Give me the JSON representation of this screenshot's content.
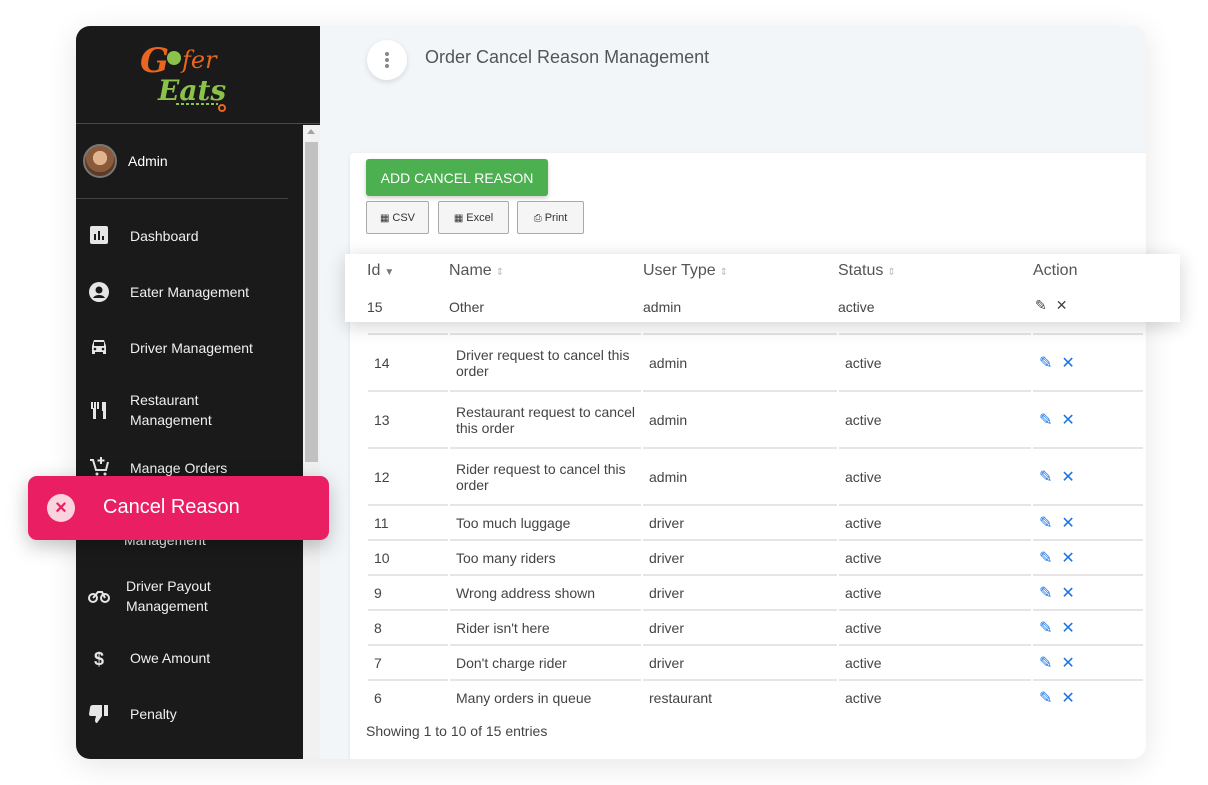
{
  "app": {
    "brand": "Gofer Eats"
  },
  "sidebar": {
    "user": {
      "name": "Admin"
    },
    "items": [
      {
        "label": "Dashboard",
        "icon": "bar-chart-icon"
      },
      {
        "label": "Eater Management",
        "icon": "account-circle-icon"
      },
      {
        "label": "Driver Management",
        "icon": "car-icon"
      },
      {
        "label": "Restaurant Management",
        "icon": "restaurant-icon"
      },
      {
        "label": "Manage Orders",
        "icon": "cart-add-icon"
      },
      {
        "label": "Management",
        "icon": "hidden-icon"
      },
      {
        "label": "Driver Payout Management",
        "icon": "bike-icon"
      },
      {
        "label": "Owe Amount",
        "icon": "dollar-icon"
      },
      {
        "label": "Penalty",
        "icon": "thumb-down-icon"
      }
    ],
    "active": {
      "label": "Cancel Reason",
      "icon": "close-circle-icon"
    }
  },
  "header": {
    "title": "Order Cancel Reason Management"
  },
  "toolbar": {
    "add_label": "ADD CANCEL REASON",
    "csv_label": "CSV",
    "excel_label": "Excel",
    "print_label": "Print"
  },
  "table": {
    "columns": [
      "Id",
      "Name",
      "User Type",
      "Status",
      "Action"
    ],
    "rows": [
      {
        "id": "15",
        "name": "Other",
        "user_type": "admin",
        "status": "active"
      },
      {
        "id": "14",
        "name": "Driver request to cancel this order",
        "user_type": "admin",
        "status": "active"
      },
      {
        "id": "13",
        "name": "Restaurant request to cancel this order",
        "user_type": "admin",
        "status": "active"
      },
      {
        "id": "12",
        "name": "Rider request to cancel this order",
        "user_type": "admin",
        "status": "active"
      },
      {
        "id": "11",
        "name": "Too much luggage",
        "user_type": "driver",
        "status": "active"
      },
      {
        "id": "10",
        "name": "Too many riders",
        "user_type": "driver",
        "status": "active"
      },
      {
        "id": "9",
        "name": "Wrong address shown",
        "user_type": "driver",
        "status": "active"
      },
      {
        "id": "8",
        "name": "Rider isn't here",
        "user_type": "driver",
        "status": "active"
      },
      {
        "id": "7",
        "name": "Don't charge rider",
        "user_type": "driver",
        "status": "active"
      },
      {
        "id": "6",
        "name": "Many orders in queue",
        "user_type": "restaurant",
        "status": "active"
      }
    ],
    "info": "Showing 1 to 10 of 15 entries"
  },
  "colors": {
    "accent": "#e91e63",
    "add_button": "#4caf50",
    "action": "#1a73e8",
    "sidebar": "#1a1a1a"
  }
}
